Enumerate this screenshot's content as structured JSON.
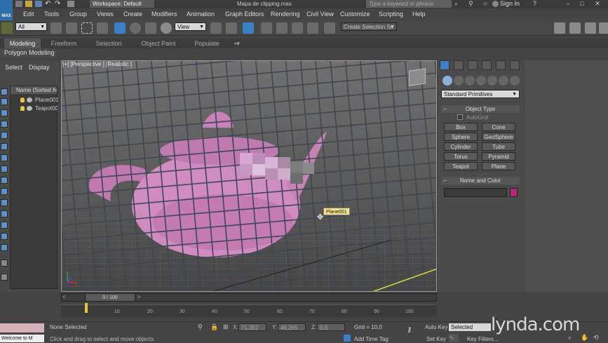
{
  "titlebar": {
    "logo": "MAX",
    "workspace_label": "Workspace: Default",
    "title": "Mapa de clipping.max",
    "search_placeholder": "Type a keyword or phrase",
    "sign_in": "Sign In",
    "window_controls": [
      "–",
      "□",
      "✕"
    ]
  },
  "menubar": {
    "items": [
      "Edit",
      "Tools",
      "Group",
      "Views",
      "Create",
      "Modifiers",
      "Animation",
      "Graph Editors",
      "Rendering",
      "Civil View",
      "Customize",
      "Scripting",
      "Help"
    ]
  },
  "toolbar": {
    "selection_filter": "All",
    "reference_coord": "View",
    "named_selection": "Create Selection Se"
  },
  "ribbon": {
    "tabs": [
      "Modeling",
      "Freeform",
      "Selection",
      "Object Paint",
      "Populate"
    ],
    "panel_label": "Polygon Modeling"
  },
  "explorer": {
    "tabs": [
      "Select",
      "Display"
    ],
    "header": "Name (Sorted Ascer",
    "rows": [
      "Plane001",
      "Teapot00"
    ]
  },
  "viewport": {
    "label": "[+] [Perspective ] [Realistic ]",
    "tooltip": "Plane001"
  },
  "command_panel": {
    "category": "Standard Primitives",
    "object_type_title": "Object Type",
    "autogrid": "AutoGrid",
    "buttons": [
      "Box",
      "Cone",
      "Sphere",
      "GeoSphere",
      "Cylinder",
      "Tube",
      "Torus",
      "Pyramid",
      "Teapot",
      "Plane"
    ],
    "name_color_title": "Name and Color",
    "color": "#b5257a"
  },
  "timeline": {
    "slider": "0 / 100",
    "ticks": [
      "10",
      "20",
      "30",
      "40",
      "50",
      "60",
      "70",
      "80",
      "90",
      "100"
    ]
  },
  "status": {
    "welcome": "Welcome to M",
    "selection": "None Selected",
    "prompt": "Click and drag to select and move objects",
    "x_label": "X:",
    "x_value": "71,352",
    "y_label": "Y:",
    "y_value": "45,265",
    "z_label": "Z:",
    "z_value": "0,0",
    "grid": "Grid = 10,0",
    "add_time_tag": "Add Time Tag",
    "auto_key": "Auto Key",
    "set_key": "Set Key",
    "selected_dd": "Selected",
    "key_filters": "Key Filters...",
    "watermark": "lynda.com"
  }
}
